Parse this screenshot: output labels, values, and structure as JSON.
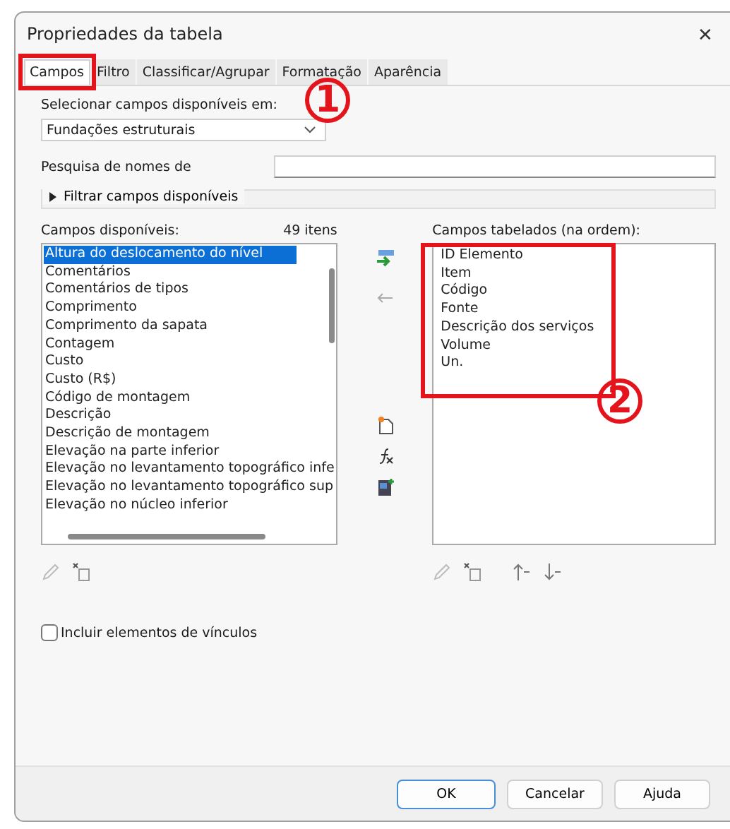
{
  "window": {
    "title": "Propriedades da tabela",
    "close": "✕"
  },
  "tabs": [
    {
      "label": "Campos",
      "selected": true
    },
    {
      "label": "Filtro",
      "selected": false
    },
    {
      "label": "Classificar/Agrupar",
      "selected": false
    },
    {
      "label": "Formatação",
      "selected": false
    },
    {
      "label": "Aparência",
      "selected": false
    }
  ],
  "source": {
    "label": "Selecionar campos disponíveis em:",
    "value": "Fundações estruturais"
  },
  "search": {
    "label": "Pesquisa de nomes de"
  },
  "filter": {
    "label": "Filtrar campos disponíveis",
    "expanded": false
  },
  "available": {
    "label": "Campos disponíveis:",
    "count": "49 itens",
    "items": [
      {
        "text": "Altura do deslocamento do nível",
        "selected": true
      },
      {
        "text": "Comentários",
        "selected": false
      },
      {
        "text": "Comentários de tipos",
        "selected": false
      },
      {
        "text": "Comprimento",
        "selected": false
      },
      {
        "text": "Comprimento da sapata",
        "selected": false
      },
      {
        "text": "Contagem",
        "selected": false
      },
      {
        "text": "Custo",
        "selected": false
      },
      {
        "text": "Custo (R$)",
        "selected": false
      },
      {
        "text": "Código de montagem",
        "selected": false
      },
      {
        "text": "Descrição",
        "selected": false
      },
      {
        "text": "Descrição de montagem",
        "selected": false
      },
      {
        "text": "Elevação na parte inferior",
        "selected": false
      },
      {
        "text": "Elevação no levantamento topográfico infe",
        "selected": false
      },
      {
        "text": "Elevação no levantamento topográfico sup",
        "selected": false
      },
      {
        "text": "Elevação no núcleo inferior",
        "selected": false
      }
    ]
  },
  "scheduled": {
    "label": "Campos tabelados (na ordem):",
    "items": [
      {
        "text": "ID Elemento"
      },
      {
        "text": "Item"
      },
      {
        "text": "Código"
      },
      {
        "text": "Fonte"
      },
      {
        "text": "Descrição dos serviços"
      },
      {
        "text": "Volume"
      },
      {
        "text": "Un."
      }
    ]
  },
  "include_links": {
    "label": "Incluir elementos de vínculos",
    "checked": false
  },
  "annotations": [
    {
      "label": "1"
    },
    {
      "label": "2"
    }
  ],
  "buttons": [
    {
      "label": "OK",
      "kind": "default"
    },
    {
      "label": "Cancelar",
      "kind": "normal"
    },
    {
      "label": "Ajuda",
      "kind": "normal"
    }
  ]
}
